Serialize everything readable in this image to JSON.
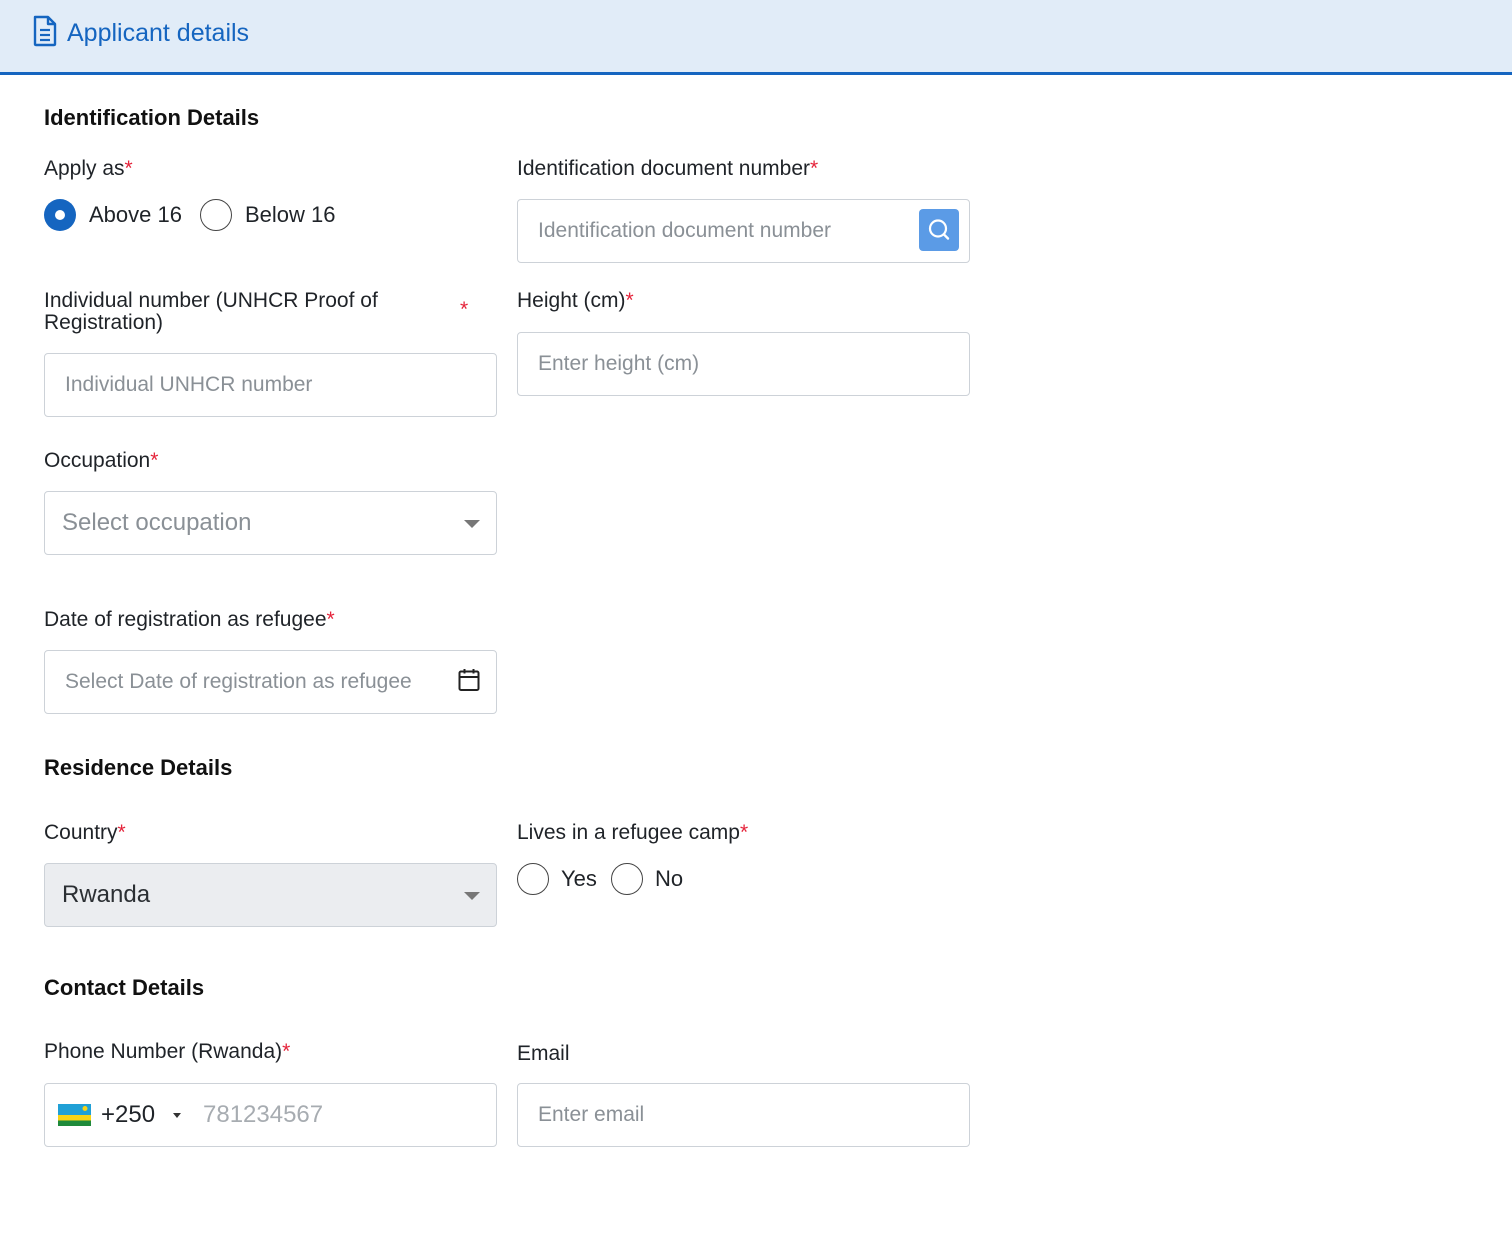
{
  "header": {
    "title": "Applicant details",
    "icon": "document-icon",
    "accent": "#1565c0",
    "background": "#e1ecf8"
  },
  "identification": {
    "title": "Identification Details",
    "apply_as": {
      "label": "Apply as",
      "required": "*",
      "options": [
        "Above 16",
        "Below 16"
      ],
      "selected": "Above 16"
    },
    "id_doc": {
      "label": "Identification document number",
      "required": "*",
      "placeholder": "Identification document number",
      "button_icon": "search-icon"
    },
    "unhcr": {
      "label": "Individual number (UNHCR Proof of Registration)",
      "required": "*",
      "placeholder": "Individual UNHCR number"
    },
    "height": {
      "label": "Height (cm)",
      "required": "*",
      "placeholder": "Enter height (cm)"
    },
    "occupation": {
      "label": "Occupation",
      "required": "*",
      "placeholder": "Select occupation"
    },
    "reg_date": {
      "label": "Date of registration as refugee",
      "required": "*",
      "placeholder": "Select Date of registration as refugee",
      "icon": "calendar-icon"
    }
  },
  "residence": {
    "title": "Residence Details",
    "country": {
      "label": "Country",
      "required": "*",
      "value": "Rwanda"
    },
    "camp": {
      "label": "Lives in a refugee camp",
      "required": "*",
      "options": [
        "Yes",
        "No"
      ],
      "selected": ""
    }
  },
  "contact": {
    "title": "Contact Details",
    "phone": {
      "label": "Phone Number (Rwanda)",
      "required": "*",
      "dial_code": "+250",
      "placeholder": "781234567",
      "flag_icon": "rwanda-flag-icon"
    },
    "email": {
      "label": "Email",
      "placeholder": "Enter email"
    }
  }
}
